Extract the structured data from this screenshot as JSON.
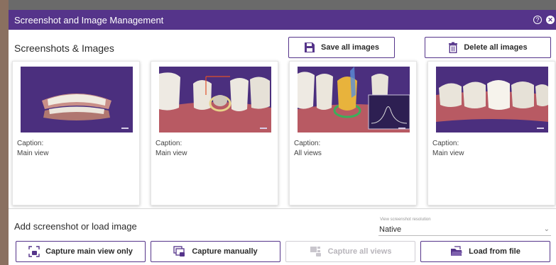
{
  "window": {
    "title": "Screenshot and Image Management"
  },
  "section": {
    "title": "Screenshots & Images",
    "save_all_label": "Save all images",
    "delete_all_label": "Delete all images"
  },
  "cards": [
    {
      "caption_label": "Caption:",
      "caption": "Main view",
      "thumbnail": "full-dental-arch-model"
    },
    {
      "caption_label": "Caption:",
      "caption": "Main view",
      "thumbnail": "crown-preparation-with-margin-line"
    },
    {
      "caption_label": "Caption:",
      "caption": "All views",
      "thumbnail": "crown-with-cross-section-graph"
    },
    {
      "caption_label": "Caption:",
      "caption": "Main view",
      "thumbnail": "lower-arch-with-crown"
    }
  ],
  "add": {
    "title": "Add screenshot or load image",
    "resolution_label": "View screenshot resolution",
    "resolution_value": "Native"
  },
  "actions": {
    "capture_main_label": "Capture main view only",
    "capture_manual_label": "Capture manually",
    "capture_all_label": "Capture all views",
    "load_file_label": "Load from file"
  },
  "colors": {
    "accent": "#55348a",
    "thumbnail_bg": "#4b2f7e",
    "disabled": "#b8b5bb"
  },
  "icons": [
    "help-icon",
    "close-icon",
    "save-icon",
    "trash-icon",
    "capture-main-icon",
    "capture-manual-icon",
    "capture-all-icon",
    "folder-open-icon"
  ]
}
